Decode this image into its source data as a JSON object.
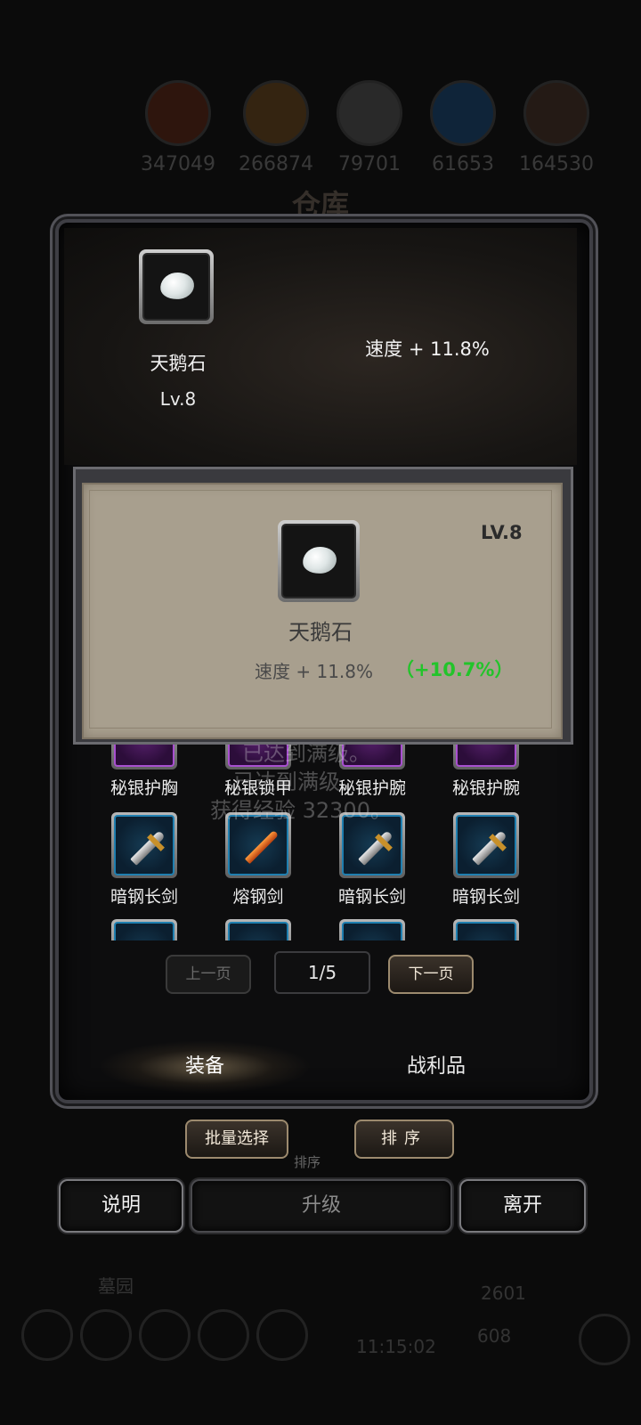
{
  "background": {
    "resources": [
      {
        "value": "347049"
      },
      {
        "value": "266874"
      },
      {
        "value": "79701"
      },
      {
        "value": "61653"
      },
      {
        "value": "164530"
      }
    ],
    "title": "仓库",
    "garden_label": "墓园",
    "coins": "2601",
    "gems": "608",
    "time": "11:15:02"
  },
  "selected_item": {
    "name": "天鹅石",
    "level": "Lv.8",
    "stat": "速度 + 11.8%"
  },
  "popup": {
    "level": "LV.8",
    "name": "天鹅石",
    "stat": "速度 + 11.8%",
    "bonus": "（+10.7%）"
  },
  "messages": {
    "line1": "已达到满级。",
    "line2": "已达到满级。",
    "line3": "获得经验 32300。"
  },
  "inventory": {
    "row1": [
      "秘银护胸",
      "秘银锁甲",
      "秘银护腕",
      "秘银护腕"
    ],
    "row2": [
      "暗钢长剑",
      "熔钢剑",
      "暗钢长剑",
      "暗钢长剑"
    ]
  },
  "pagination": {
    "prev_label": "上一页",
    "page": "1/5",
    "next_label": "下一页"
  },
  "tabs": {
    "equipment": "装备",
    "loot": "战利品"
  },
  "actions": {
    "batch_select": "批量选择",
    "sort": "排序",
    "sort_ghost": "排序",
    "help": "说明",
    "upgrade": "升级",
    "leave": "离开"
  },
  "colors": {
    "bonus_green": "#22c42a",
    "popup_bg": "#a89f8e",
    "rare_blue": "#1f7fb0",
    "epic_purple": "#a84fd0"
  }
}
